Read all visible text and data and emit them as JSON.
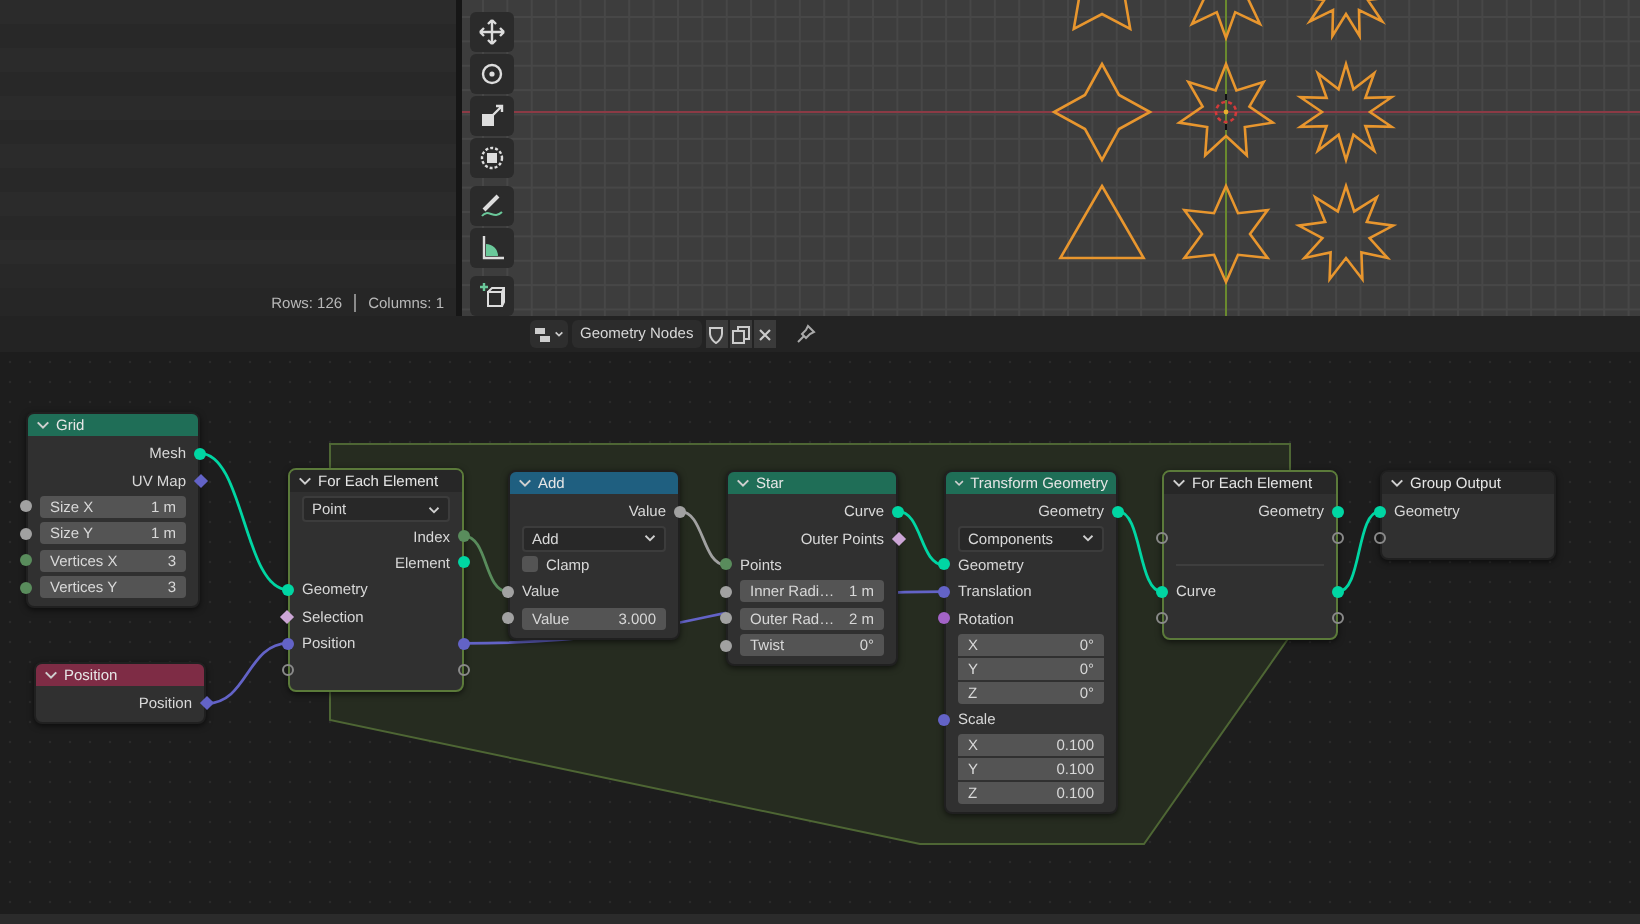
{
  "spreadsheet": {
    "rows_label": "Rows: 126",
    "columns_label": "Columns: 1"
  },
  "node_tree": {
    "name": "Geometry Nodes"
  },
  "nodes": [
    {
      "title": "Grid",
      "kind": "node",
      "color": "#1f6e57",
      "rows": [
        {
          "kind": "socket",
          "label": "Mesh",
          "out": {
            "kind": "circle",
            "color": "#00d6a3"
          }
        },
        {
          "kind": "socket",
          "label": "UV Map",
          "out": {
            "kind": "diamond",
            "color": "#6363c7"
          }
        },
        {
          "kind": "field",
          "label": "Size X",
          "value": "1 m",
          "in": {
            "kind": "circle",
            "color": "#a1a1a1"
          }
        },
        {
          "kind": "field",
          "label": "Size Y",
          "value": "1 m",
          "in": {
            "kind": "circle",
            "color": "#a1a1a1"
          }
        },
        {
          "kind": "field",
          "label": "Vertices X",
          "value": "3",
          "in": {
            "kind": "circle",
            "color": "#598c5c"
          }
        },
        {
          "kind": "field",
          "label": "Vertices Y",
          "value": "3",
          "in": {
            "kind": "circle",
            "color": "#598c5c"
          }
        }
      ]
    },
    {
      "title": "Position",
      "kind": "node",
      "color": "#7e2c45",
      "rows": [
        {
          "kind": "socket",
          "label": "Position",
          "out": {
            "kind": "diamond",
            "color": "#6363c7"
          }
        }
      ]
    },
    {
      "title": "For Each Element",
      "kind": "zone",
      "color": "#272727",
      "rows": [
        {
          "kind": "dropdown",
          "value": "Point"
        },
        {
          "kind": "socket",
          "label": "Index",
          "out": {
            "kind": "circle",
            "color": "#598c5c"
          }
        },
        {
          "kind": "socket",
          "label": "Element",
          "out": {
            "kind": "circle",
            "color": "#00d6a3"
          }
        },
        {
          "kind": "socket",
          "label": "Geometry",
          "in": {
            "kind": "circle",
            "color": "#00d6a3"
          }
        },
        {
          "kind": "socket",
          "label": "Selection",
          "in": {
            "kind": "diamond",
            "color": "#cca6d6"
          }
        },
        {
          "kind": "socket",
          "label": "Position",
          "in": {
            "kind": "circle",
            "color": "#6363c7"
          },
          "out": {
            "kind": "circle",
            "color": "#6363c7"
          }
        },
        {
          "kind": "socket",
          "in": {
            "kind": "ring"
          },
          "out": {
            "kind": "ring"
          }
        }
      ]
    },
    {
      "title": "Add",
      "kind": "node",
      "color": "#1f5f80",
      "rows": [
        {
          "kind": "socket",
          "label": "Value",
          "out": {
            "kind": "circle",
            "color": "#a1a1a1"
          }
        },
        {
          "kind": "dropdown",
          "value": "Add"
        },
        {
          "kind": "checkbox",
          "label": "Clamp",
          "checked": false
        },
        {
          "kind": "socket",
          "label": "Value",
          "in": {
            "kind": "circle",
            "color": "#a1a1a1"
          }
        },
        {
          "kind": "field",
          "label": "Value",
          "value": "3.000",
          "in": {
            "kind": "circle",
            "color": "#a1a1a1"
          }
        }
      ]
    },
    {
      "title": "Star",
      "kind": "node",
      "color": "#1f6e57",
      "rows": [
        {
          "kind": "socket",
          "label": "Curve",
          "out": {
            "kind": "circle",
            "color": "#00d6a3"
          }
        },
        {
          "kind": "socket",
          "label": "Outer Points",
          "out": {
            "kind": "diamond",
            "color": "#cca6d6"
          }
        },
        {
          "kind": "socket",
          "label": "Points",
          "in": {
            "kind": "circle",
            "color": "#598c5c"
          }
        },
        {
          "kind": "field",
          "label": "Inner Radi…",
          "value": "1 m",
          "in": {
            "kind": "circle",
            "color": "#a1a1a1"
          }
        },
        {
          "kind": "field",
          "label": "Outer Rad…",
          "value": "2 m",
          "in": {
            "kind": "circle",
            "color": "#a1a1a1"
          }
        },
        {
          "kind": "field",
          "label": "Twist",
          "value": "0°",
          "in": {
            "kind": "circle",
            "color": "#a1a1a1"
          }
        }
      ]
    },
    {
      "title": "Transform Geometry",
      "kind": "node",
      "color": "#1f6e57",
      "rows": [
        {
          "kind": "socket",
          "label": "Geometry",
          "out": {
            "kind": "circle",
            "color": "#00d6a3"
          }
        },
        {
          "kind": "dropdown",
          "value": "Components"
        },
        {
          "kind": "socket",
          "label": "Geometry",
          "in": {
            "kind": "circle",
            "color": "#00d6a3"
          }
        },
        {
          "kind": "socket",
          "label": "Translation",
          "in": {
            "kind": "circle",
            "color": "#6363c7"
          }
        },
        {
          "kind": "socket",
          "label": "Rotation",
          "in": {
            "kind": "circle",
            "color": "#a363c7"
          }
        },
        {
          "kind": "vector",
          "fields": [
            {
              "label": "X",
              "value": "0°"
            },
            {
              "label": "Y",
              "value": "0°"
            },
            {
              "label": "Z",
              "value": "0°"
            }
          ]
        },
        {
          "kind": "socket",
          "label": "Scale",
          "in": {
            "kind": "circle",
            "color": "#6363c7"
          }
        },
        {
          "kind": "vector",
          "fields": [
            {
              "label": "X",
              "value": "0.100"
            },
            {
              "label": "Y",
              "value": "0.100"
            },
            {
              "label": "Z",
              "value": "0.100"
            }
          ]
        }
      ]
    },
    {
      "title": "For Each Element",
      "kind": "zone",
      "color": "#272727",
      "rows": [
        {
          "kind": "socket",
          "label": "Geometry",
          "out": {
            "kind": "circle",
            "color": "#00d6a3"
          }
        },
        {
          "kind": "socket",
          "in": {
            "kind": "ring"
          },
          "out": {
            "kind": "ring"
          }
        },
        {
          "kind": "divider"
        },
        {
          "kind": "socket",
          "label": "Curve",
          "in": {
            "kind": "circle",
            "color": "#00d6a3"
          },
          "out": {
            "kind": "circle",
            "color": "#00d6a3"
          }
        },
        {
          "kind": "socket",
          "in": {
            "kind": "ring"
          },
          "out": {
            "kind": "ring"
          }
        }
      ]
    },
    {
      "title": "Group Output",
      "kind": "node",
      "color": "#272727",
      "rows": [
        {
          "kind": "socket",
          "label": "Geometry",
          "in": {
            "kind": "circle",
            "color": "#00d6a3"
          }
        },
        {
          "kind": "socket",
          "in": {
            "kind": "ring"
          }
        }
      ]
    }
  ]
}
